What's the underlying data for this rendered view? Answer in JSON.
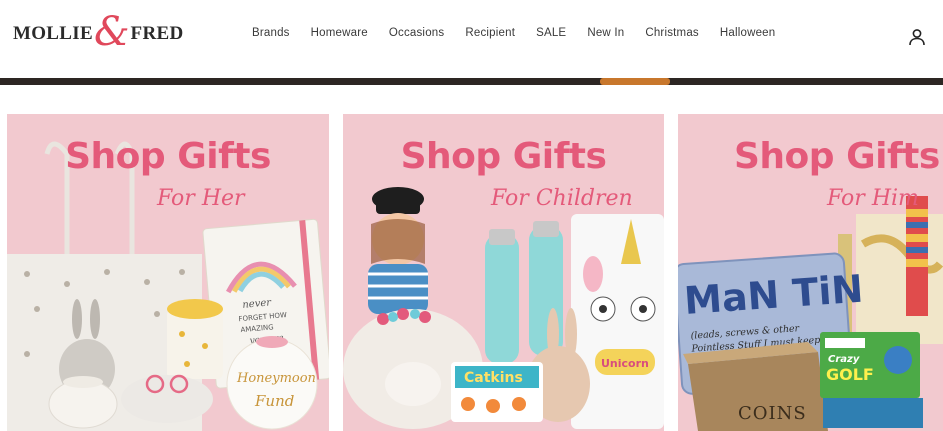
{
  "brand": {
    "word1": "MOLLIE",
    "amp": "&",
    "word2": "FRED"
  },
  "nav": {
    "items": [
      "Brands",
      "Homeware",
      "Occasions",
      "Recipient",
      "SALE",
      "New In",
      "Christmas",
      "Halloween"
    ]
  },
  "account_icon": "user-icon",
  "colors": {
    "card_bg": "#f2c9cf",
    "title_pink": "#e45a7a",
    "logo_amp": "#e0485b"
  },
  "cards": [
    {
      "title": "Shop Gifts",
      "subtitle": "For Her",
      "product_text": {
        "notebook": "never forget how amazing you are",
        "jar": "Honeymoon Fund"
      }
    },
    {
      "title": "Shop Gifts",
      "subtitle": "For Children",
      "product_text": {
        "game": "Catkins",
        "book": "Unicorn"
      }
    },
    {
      "title": "Shop Gifts",
      "subtitle": "For Him",
      "product_text": {
        "tin": "MaN TiN",
        "tin_sub": "(leads, screws & other Pointless Stuff I must keep)",
        "box": "COINS",
        "game": "Crazy GOLF"
      }
    }
  ]
}
